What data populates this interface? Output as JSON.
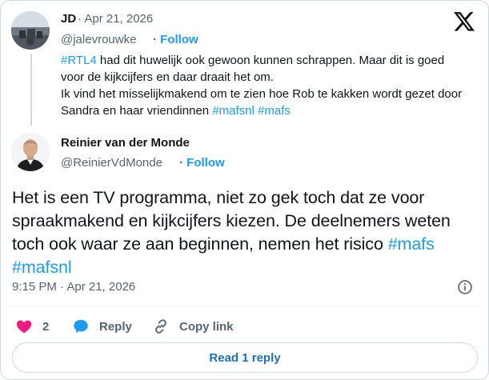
{
  "quoted_post": {
    "author_name": "JD",
    "date": "Apr 21, 2026",
    "handle": "@jalevrouwke",
    "follow_label": "Follow",
    "text_parts": [
      {
        "text": "#RTL4",
        "tag": true
      },
      {
        "text": " had dit huwelijk ook gewoon kunnen schrappen. Maar dit is goed voor de kijkcijfers en daar draait het om.",
        "tag": false
      },
      {
        "text": "\nIk vind het misselijkmakend om te zien hoe Rob te kakken wordt gezet door Sandra en haar vriendinnen ",
        "tag": false
      },
      {
        "text": "#mafsnl",
        "tag": true
      },
      {
        "text": " ",
        "tag": false
      },
      {
        "text": "#mafs",
        "tag": true
      }
    ]
  },
  "reply_post": {
    "author_name": "Reinier van der Monde",
    "handle": "@ReinierVdMonde",
    "follow_label": "Follow",
    "text_parts": [
      {
        "text": "Het is een TV programma, niet zo gek toch dat ze voor spraakmakend en kijkcijfers kiezen. De deelnemers weten toch ook waar ze aan beginnen, nemen het risico ",
        "tag": false
      },
      {
        "text": "#mafs",
        "tag": true
      },
      {
        "text": "\n",
        "tag": false
      },
      {
        "text": "#mafsnl",
        "tag": true
      }
    ],
    "timestamp": "9:15 PM · Apr 21, 2026"
  },
  "actions": {
    "like_count": "2",
    "reply_label": "Reply",
    "copy_link_label": "Copy link"
  },
  "read_replies_label": "Read 1 reply",
  "icons": {
    "brand": "x-logo-icon",
    "info": "info-icon",
    "like": "heart-icon",
    "reply": "speech-bubble-icon",
    "copy": "link-icon"
  },
  "colors": {
    "accent": "#1d9bf0",
    "like": "#f91880",
    "muted": "#536471",
    "text": "#0f1419"
  }
}
